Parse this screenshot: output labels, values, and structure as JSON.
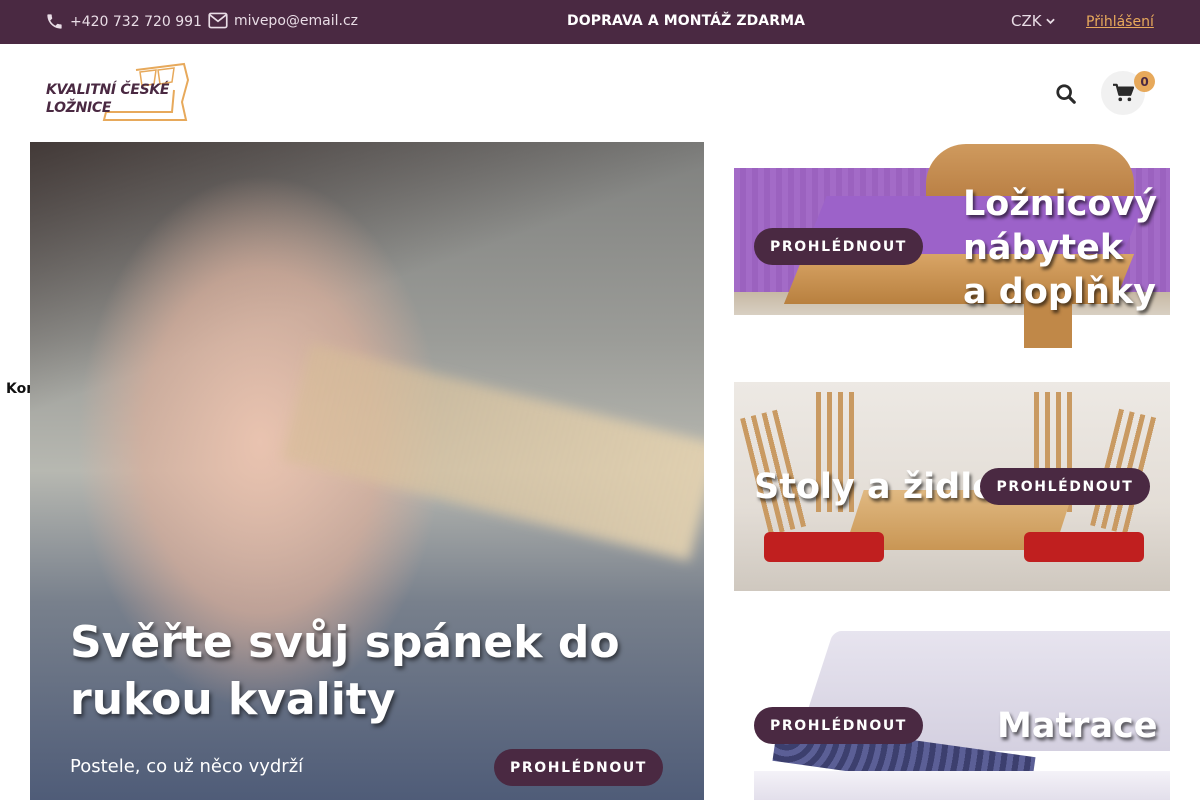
{
  "topbar": {
    "phone": "+420 732 720 991",
    "email": "mivepo@email.cz",
    "promo": "DOPRAVA A MONTÁŽ ZDARMA",
    "currency": "CZK",
    "login": "Přihlášení"
  },
  "logo": {
    "line1": "KVALITNÍ ČESKÉ",
    "line2": "LOŽNICE"
  },
  "cart": {
    "count": "0"
  },
  "side": {
    "contact": "Kontakt"
  },
  "hero": {
    "title": "Svěřte svůj spánek do rukou kvality",
    "subtitle": "Postele, co už něco vydrží",
    "button": "PROHLÉDNOUT"
  },
  "categories": [
    {
      "title_line1": "Ložnicový",
      "title_line2": "nábytek",
      "title_line3": "a doplňky",
      "button": "PROHLÉDNOUT"
    },
    {
      "title": "Stoly a židle",
      "button": "PROHLÉDNOUT"
    },
    {
      "title": "Matrace",
      "button": "PROHLÉDNOUT"
    }
  ],
  "colors": {
    "primary": "#4a2942",
    "accent": "#e7a95b"
  },
  "icons": [
    "phone-icon",
    "envelope-icon",
    "chevron-down-icon",
    "search-icon",
    "shopping-cart-icon"
  ]
}
